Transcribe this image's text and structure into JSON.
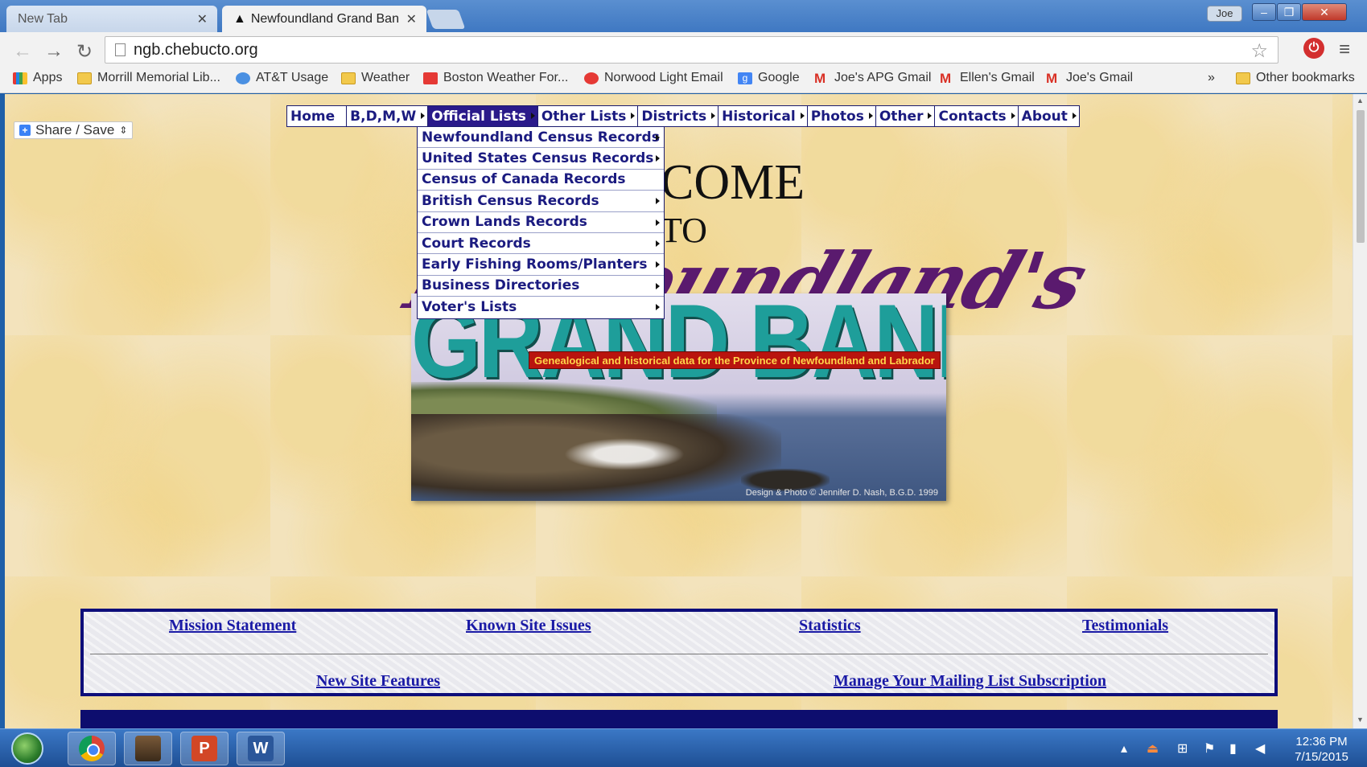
{
  "browser": {
    "tabs": [
      {
        "label": "New Tab",
        "active": false
      },
      {
        "label": "Newfoundland Grand Ban",
        "active": true
      }
    ],
    "user": "Joe",
    "url": "ngb.chebucto.org",
    "bookmarks": [
      {
        "label": "Apps",
        "icon": "apps-icon"
      },
      {
        "label": "Morrill Memorial Lib...",
        "icon": "folder-icon"
      },
      {
        "label": "AT&T Usage",
        "icon": "att-icon"
      },
      {
        "label": "Weather",
        "icon": "folder-icon"
      },
      {
        "label": "Boston Weather For...",
        "icon": "bos-icon"
      },
      {
        "label": "Norwood Light Email",
        "icon": "nor-icon"
      },
      {
        "label": "Google",
        "icon": "g-icon"
      },
      {
        "label": "Joe's APG Gmail",
        "icon": "gmail-icon"
      },
      {
        "label": "Ellen's Gmail",
        "icon": "gmail-icon"
      },
      {
        "label": "Joe's Gmail",
        "icon": "gmail-icon"
      }
    ],
    "overflow": "»",
    "other_bookmarks": "Other bookmarks"
  },
  "page": {
    "share_label": "Share / Save",
    "menu": [
      {
        "label": "Home",
        "selected": false
      },
      {
        "label": "B,D,M,W",
        "selected": false
      },
      {
        "label": "Official Lists",
        "selected": true
      },
      {
        "label": "Other Lists",
        "selected": false
      },
      {
        "label": "Districts",
        "selected": false
      },
      {
        "label": "Historical",
        "selected": false
      },
      {
        "label": "Photos",
        "selected": false
      },
      {
        "label": "Other",
        "selected": false
      },
      {
        "label": "Contacts",
        "selected": false
      },
      {
        "label": "About",
        "selected": false
      }
    ],
    "dropdown": [
      {
        "label": "Newfoundland Census Records",
        "submenu": true
      },
      {
        "label": "United States Census Records",
        "submenu": true
      },
      {
        "label": "Census of Canada Records",
        "submenu": false
      },
      {
        "label": "British Census Records",
        "submenu": true
      },
      {
        "label": "Crown Lands Records",
        "submenu": true
      },
      {
        "label": "Court Records",
        "submenu": true
      },
      {
        "label": "Early Fishing Rooms/Planters",
        "submenu": true
      },
      {
        "label": "Business Directories",
        "submenu": true
      },
      {
        "label": "Voter's Lists",
        "submenu": true
      }
    ],
    "welcome_line1": "COME",
    "welcome_line2": "TO",
    "banner": {
      "script": "Newfoundland's",
      "title": "GRAND BANKS",
      "tagline": "Genealogical and historical data for the Province of Newfoundland and Labrador",
      "credit": "Design & Photo © Jennifer D. Nash, B.G.D. 1999"
    },
    "links": {
      "mission": "Mission Statement",
      "issues": "Known Site Issues",
      "statistics": "Statistics",
      "testimonials": "Testimonials",
      "features": "New Site Features",
      "mailing": "Manage Your Mailing List Subscription"
    }
  },
  "taskbar": {
    "time": "12:36 PM",
    "date": "7/15/2015"
  },
  "colors": {
    "menu_text": "#1b1b80",
    "menu_selected_bg": "#2a1a8a",
    "page_bg": "#f3e3bc",
    "link_box_border": "#0d0d7a",
    "grand_banks_teal": "#1e9e9a",
    "tagline_bg": "#b9140e"
  }
}
